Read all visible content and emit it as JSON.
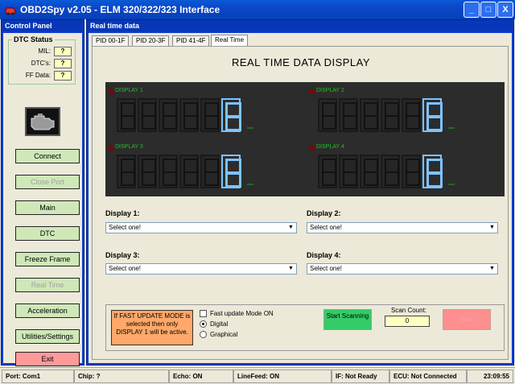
{
  "window": {
    "title": "OBD2Spy v2.05 - ELM 320/322/323 Interface",
    "min_label": "_",
    "max_label": "□",
    "close_label": "X"
  },
  "control_panel": {
    "header": "Control Panel",
    "dtc_status": {
      "title": "DTC Status",
      "rows": [
        {
          "label": "MIL:",
          "value": "?"
        },
        {
          "label": "DTC's:",
          "value": "?"
        },
        {
          "label": "FF Data:",
          "value": "?"
        }
      ]
    },
    "buttons": [
      {
        "label": "Connect",
        "enabled": true
      },
      {
        "label": "Close Port",
        "enabled": false
      },
      {
        "label": "Main",
        "enabled": true
      },
      {
        "label": "DTC",
        "enabled": true
      },
      {
        "label": "Freeze Frame",
        "enabled": true
      },
      {
        "label": "Real Time",
        "enabled": false
      },
      {
        "label": "Acceleration",
        "enabled": true
      },
      {
        "label": "Utilities/Settings",
        "enabled": true
      },
      {
        "label": "Exit",
        "enabled": true
      }
    ]
  },
  "main": {
    "header": "Real time data",
    "tabs": [
      {
        "label": "PID 00-1F",
        "active": false
      },
      {
        "label": "PID 20-3F",
        "active": false
      },
      {
        "label": "PID 41-4F",
        "active": false
      },
      {
        "label": "Real Time",
        "active": true
      }
    ],
    "title": "REAL TIME DATA DISPLAY",
    "displays": [
      {
        "name": "DISPLAY 1",
        "value": "0",
        "unit": "---"
      },
      {
        "name": "DISPLAY 2",
        "value": "0",
        "unit": "---"
      },
      {
        "name": "DISPLAY 3",
        "value": "0",
        "unit": "---"
      },
      {
        "name": "DISPLAY 4",
        "value": "0",
        "unit": "---"
      }
    ],
    "selectors": [
      {
        "label": "Display 1:",
        "value": "Select one!"
      },
      {
        "label": "Display 2:",
        "value": "Select one!"
      },
      {
        "label": "Display 3:",
        "value": "Select one!"
      },
      {
        "label": "Display 4:",
        "value": "Select one!"
      }
    ],
    "fast_update_note": "If FAST UPDATE MODE is selected then only DISPLAY 1 will be active.",
    "options": {
      "fast_update": "Fast update Mode ON",
      "digital": "Digital",
      "graphical": "Graphical",
      "digital_selected": true
    },
    "start_button": "Start Scanning",
    "scan_count_label": "Scan Count:",
    "scan_count": "0",
    "stop_button": "Stop"
  },
  "statusbar": {
    "port": "Port: Com1",
    "chip": "Chip: ?",
    "echo": "Echo: ON",
    "linefeed": "LineFeed: ON",
    "interface": "IF: Not Ready",
    "ecu": "ECU: Not Connected",
    "time": "23:09:55"
  },
  "colors": {
    "title_bar": "#0b47c8",
    "panel_frame": "#0b3cd0",
    "button_green": "#cfe8b8",
    "exit_red": "#ff9a9a",
    "start_green": "#33cc66",
    "digit_blue": "#7ec3ff",
    "unit_green": "#22c022",
    "note_orange": "#ffa86a"
  }
}
